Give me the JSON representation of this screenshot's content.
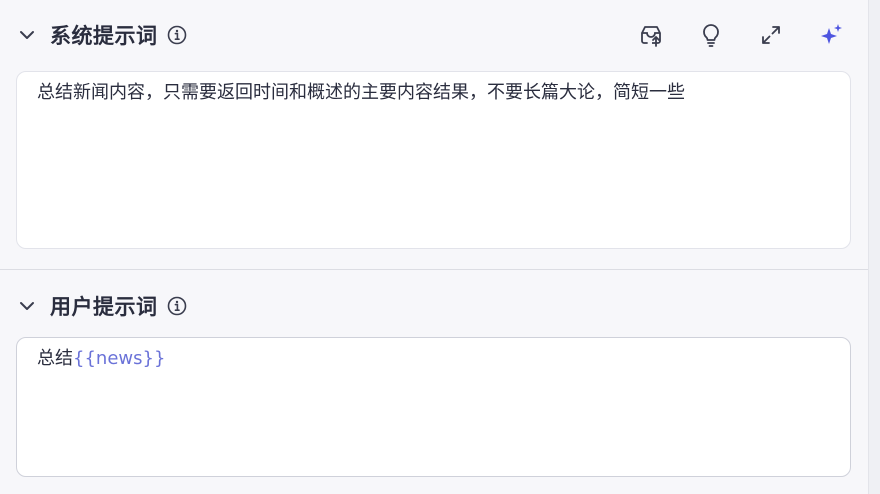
{
  "system_prompt": {
    "title": "系统提示词",
    "content": "总结新闻内容，只需要返回时间和概述的主要内容结果，不要长篇大论，简短一些",
    "toolbar": [
      "template-import-icon",
      "lightbulb-icon",
      "expand-icon",
      "sparkle-icon"
    ]
  },
  "user_prompt": {
    "title": "用户提示词",
    "content_prefix": "总结",
    "variable": "{{news}}"
  },
  "colors": {
    "accent": "#4e55e0",
    "variable": "#6a72d8",
    "title": "#2a2d3e",
    "icon": "#3a3d4e"
  }
}
